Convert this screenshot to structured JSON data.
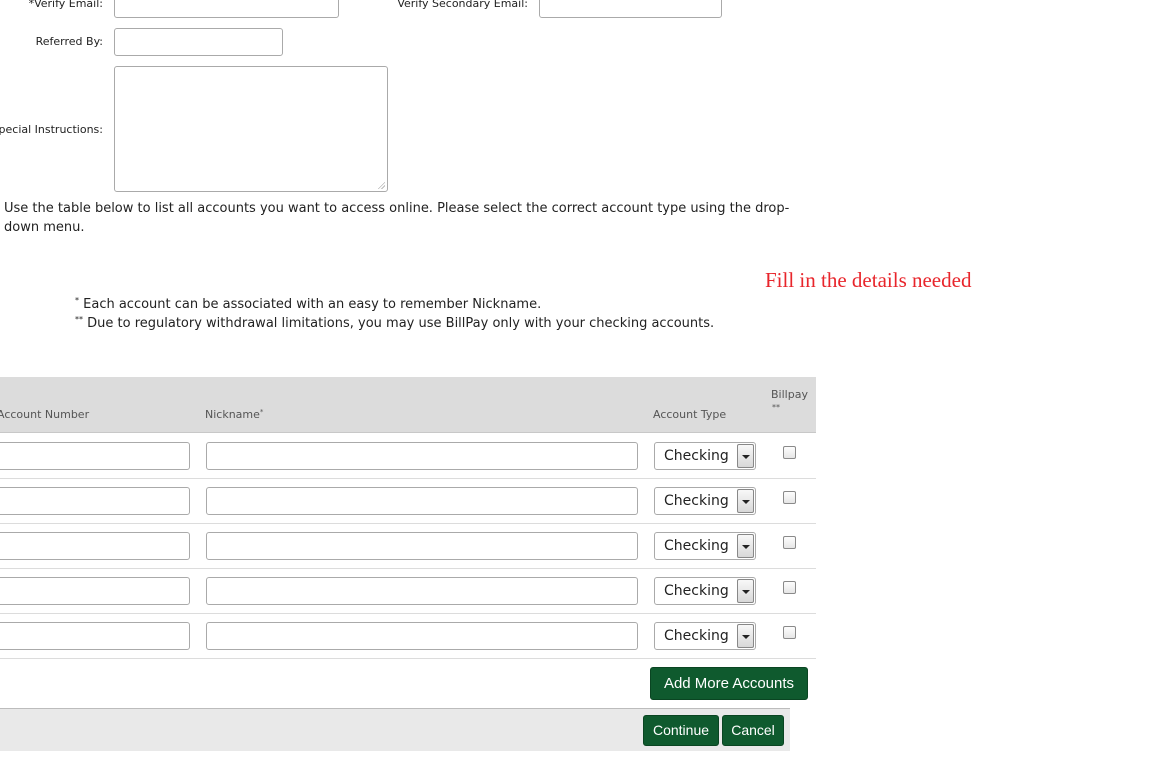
{
  "form": {
    "verify_email_label": "*Verify Email:",
    "verify_email_value": "",
    "verify_secondary_email_label": "Verify Secondary Email:",
    "verify_secondary_email_value": "",
    "referred_by_label": "Referred By:",
    "referred_by_value": "",
    "special_instructions_label": "Special Instructions:",
    "special_instructions_value": ""
  },
  "instructions": "Use the table below to list all accounts you want to access online. Please select the correct account type using the drop-down menu.",
  "hint": "Fill in the details needed",
  "notes": {
    "note1_mark": "*",
    "note1_text": " Each account can be associated with an easy to remember Nickname.",
    "note2_mark": "**",
    "note2_text": " Due to regulatory withdrawal limitations, you may use BillPay only with your checking accounts."
  },
  "table": {
    "headers": {
      "account_number": "Account Number",
      "nickname": "Nickname",
      "nickname_mark": "*",
      "account_type": "Account Type",
      "billpay": "Billpay",
      "billpay_mark": "**"
    },
    "rows": [
      {
        "account_number": "",
        "nickname": "",
        "account_type": "Checking",
        "billpay": false
      },
      {
        "account_number": "",
        "nickname": "",
        "account_type": "Checking",
        "billpay": false
      },
      {
        "account_number": "",
        "nickname": "",
        "account_type": "Checking",
        "billpay": false
      },
      {
        "account_number": "",
        "nickname": "",
        "account_type": "Checking",
        "billpay": false
      },
      {
        "account_number": "",
        "nickname": "",
        "account_type": "Checking",
        "billpay": false
      }
    ]
  },
  "buttons": {
    "add_more": "Add More Accounts",
    "continue": "Continue",
    "cancel": "Cancel"
  },
  "colors": {
    "button_green": "#0f5a2e",
    "hint_red": "#e8252b",
    "table_header_bg": "#dcdcdc"
  }
}
